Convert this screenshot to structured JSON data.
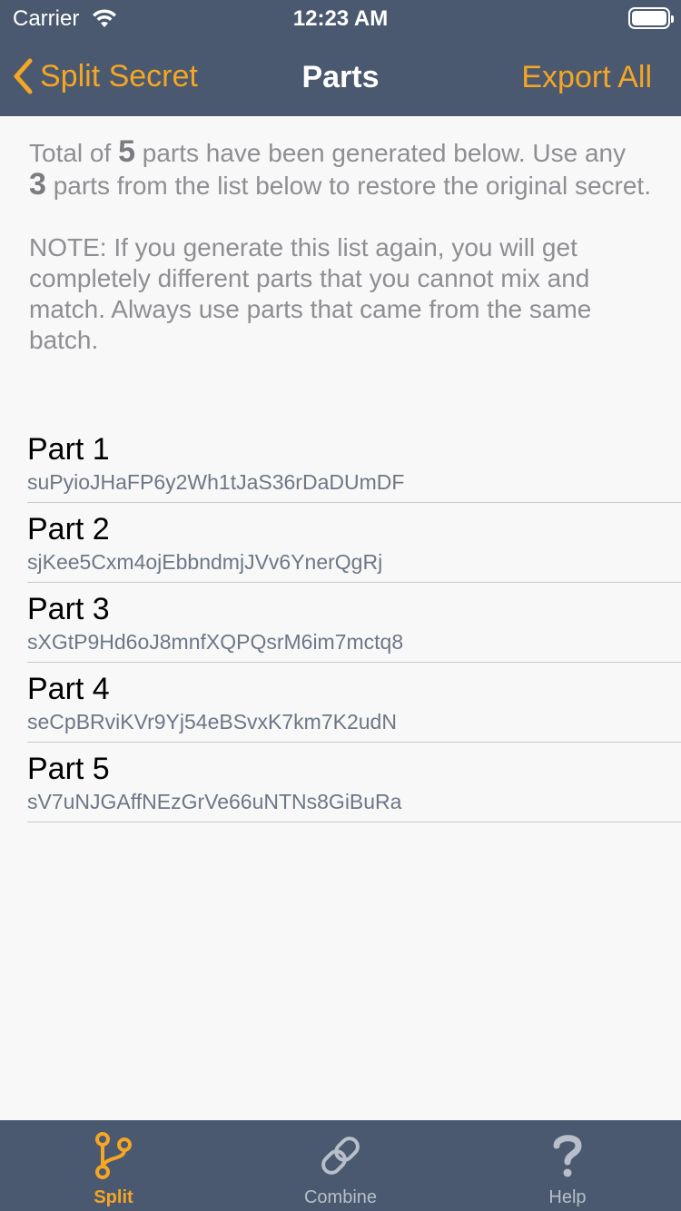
{
  "status_bar": {
    "carrier": "Carrier",
    "time": "12:23 AM"
  },
  "nav": {
    "back_label": "Split Secret",
    "title": "Parts",
    "export_label": "Export All"
  },
  "info": {
    "total_prefix": "Total of ",
    "total_count": "5",
    "total_mid": " parts have been generated below. Use any ",
    "use_count": "3",
    "total_suffix": " parts from the list below to restore the original secret.",
    "note": "NOTE: If you generate this list again, you will get completely different parts that you cannot mix and match. Always use parts that came from the same batch."
  },
  "parts": [
    {
      "title": "Part 1",
      "value": "suPyioJHaFP6y2Wh1tJaS36rDaDUmDF"
    },
    {
      "title": "Part 2",
      "value": "sjKee5Cxm4ojEbbndmjJVv6YnerQgRj"
    },
    {
      "title": "Part 3",
      "value": "sXGtP9Hd6oJ8mnfXQPQsrM6im7mctq8"
    },
    {
      "title": "Part 4",
      "value": "seCpBRviKVr9Yj54eBSvxK7km7K2udN"
    },
    {
      "title": "Part 5",
      "value": "sV7uNJGAffNEzGrVe66uNTNs8GiBuRa"
    }
  ],
  "tabs": [
    {
      "label": "Split",
      "icon": "branch-icon",
      "active": true
    },
    {
      "label": "Combine",
      "icon": "link-icon",
      "active": false
    },
    {
      "label": "Help",
      "icon": "question-icon",
      "active": false
    }
  ],
  "colors": {
    "bar_background": "#4a596f",
    "accent": "#f5a623",
    "page_background": "#f8f8f8"
  }
}
